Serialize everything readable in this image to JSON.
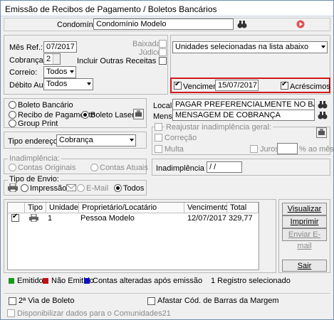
{
  "window": {
    "title": "Emissão de Recibos de Pagamento / Boletos Bancários"
  },
  "condominio": {
    "label": "Condomínio:",
    "value": "Condomínio Modelo"
  },
  "left_panel": {
    "mes_ref_label": "Mês Ref.:",
    "mes_ref_value": "07/2017",
    "cobranca_label": "Cobrança:",
    "cobranca_value": "2",
    "correio_label": "Correio:",
    "correio_value": "Todos",
    "debito_label": "Débito Aut.:",
    "debito_value": "Todos",
    "baixadas_label": "Baixadas",
    "judice_label": "Júdice",
    "incluir_label": "Incluir Outras Receitas"
  },
  "right_panel": {
    "unidades_value": "Unidades selecionadas na lista abaixo",
    "vencimento_label": "Vencimento",
    "vencimento_value": "15/07/2017",
    "acrescimos_label": "Acréscimos"
  },
  "type_panel": {
    "boleto_bancario": "Boleto Bancário",
    "recibo_pagamento": "Recibo de Pagamento",
    "boleto_laser": "Boleto Laser",
    "group_print": "Group Print"
  },
  "local": {
    "label": "Local:",
    "value": "PAGAR PREFERENCIALMENTE NO BANCO ITAU"
  },
  "mens": {
    "label": "Mens:",
    "value": "MENSAGEM DE COBRANÇA"
  },
  "reajustar": {
    "label": "Reajustar inadimplência geral:",
    "correcao": "Correção",
    "multa": "Multa",
    "juros": "Juros",
    "ao_mes": "% ao mês"
  },
  "tipo_endereco": {
    "label": "Tipo endereço:",
    "value": "Cobrança"
  },
  "inadimplencia": {
    "legend": "Inadimplência:",
    "originais": "Contas Originais",
    "atuais": "Contas Atuais"
  },
  "inadimplencia_ate": {
    "label": "Inadimplência até:",
    "value": "/ /"
  },
  "tipo_envio": {
    "legend": "Tipo de Envio:",
    "impressao": "Impressão",
    "email": "E-Mail",
    "todos": "Todos"
  },
  "grid": {
    "columns": [
      "Tipo",
      "Unidade",
      "Proprietário/Locatário",
      "Vencimento",
      "Total"
    ],
    "rows": [
      {
        "unidade": "1",
        "proprietario": "Pessoa Modelo",
        "vencimento": "12/07/2017",
        "total": "329,77"
      }
    ]
  },
  "buttons": {
    "visualizar": "Visualizar",
    "imprimir": "Imprimir",
    "enviar_email": "Enviar E-mail",
    "sair": "Sair"
  },
  "legend": {
    "emitido": "Emitido",
    "nao_emitido": "Não Emitido",
    "alteradas": "Contas alteradas após emissão",
    "selected_count": "1 Registro selecionado",
    "colors": {
      "emitido": "#1a9a1a",
      "nao_emitido": "#c01010",
      "alteradas": "#1010c0"
    }
  },
  "footer": {
    "segunda_via": "2ª Via de Boleto",
    "afastar": "Afastar Cód. de Barras da Margem",
    "disponibilizar": "Disponibilizar dados para o Comunidades21"
  },
  "icons": {
    "binoculars": "binoculars-icon",
    "go": "go-icon",
    "printer": "printer-icon",
    "settings": "settings-icon"
  }
}
